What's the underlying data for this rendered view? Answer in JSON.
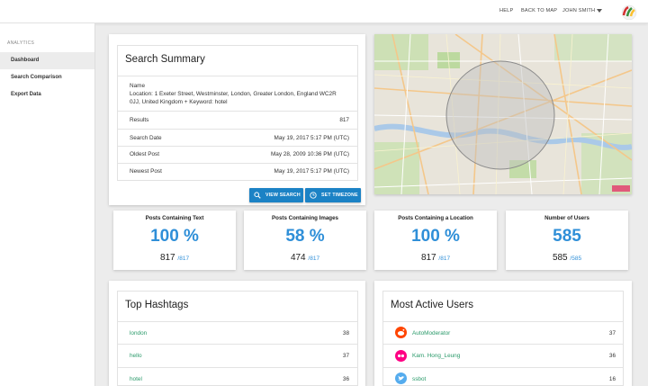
{
  "topbar": {
    "help": "HELP",
    "back_to_map": "BACK TO MAP",
    "user_name": "JOHN SMITH"
  },
  "sidebar": {
    "section": "ANALYTICS",
    "items": [
      {
        "label": "Dashboard"
      },
      {
        "label": "Search Comparison"
      },
      {
        "label": "Export Data"
      }
    ]
  },
  "summary": {
    "title": "Search Summary",
    "name_label": "Name",
    "name_line1": "Location: 1 Exeter Street, Westminster, London, Greater London, England WC2R",
    "name_line2": "0JJ, United Kingdom + Keyword: hotel",
    "rows": [
      {
        "label": "Results",
        "value": "817"
      },
      {
        "label": "Search Date",
        "value": "May 19, 2017 5:17 PM (UTC)"
      },
      {
        "label": "Oldest Post",
        "value": "May 28, 2009 10:36 PM (UTC)"
      },
      {
        "label": "Newest Post",
        "value": "May 19, 2017 5:17 PM (UTC)"
      }
    ],
    "view_search": "VIEW SEARCH",
    "set_timezone": "SET TIMEZONE"
  },
  "stats": [
    {
      "title": "Posts Containing Text",
      "big": "100 %",
      "count": "817",
      "total": "/817"
    },
    {
      "title": "Posts Containing Images",
      "big": "58 %",
      "count": "474",
      "total": "/817"
    },
    {
      "title": "Posts Containing a Location",
      "big": "100 %",
      "count": "817",
      "total": "/817"
    },
    {
      "title": "Number of Users",
      "big": "585",
      "count": "585",
      "total": "/585"
    }
  ],
  "hashtags": {
    "title": "Top Hashtags",
    "items": [
      {
        "label": "london",
        "value": "38"
      },
      {
        "label": "hello",
        "value": "37"
      },
      {
        "label": "hotel",
        "value": "36"
      }
    ]
  },
  "users": {
    "title": "Most Active Users",
    "items": [
      {
        "label": "AutoModerator",
        "value": "37",
        "icon": "reddit-icon",
        "color": "#ff4500"
      },
      {
        "label": "Kam. Hong_Leung",
        "value": "36",
        "icon": "flickr-icon",
        "color": "#ff0084"
      },
      {
        "label": "ssbot",
        "value": "16",
        "icon": "twitter-icon",
        "color": "#55acee"
      }
    ]
  },
  "colors": {
    "accent": "#1b82c5",
    "stat_blue": "#2f8fd8",
    "link_green": "#2a9a6a"
  }
}
